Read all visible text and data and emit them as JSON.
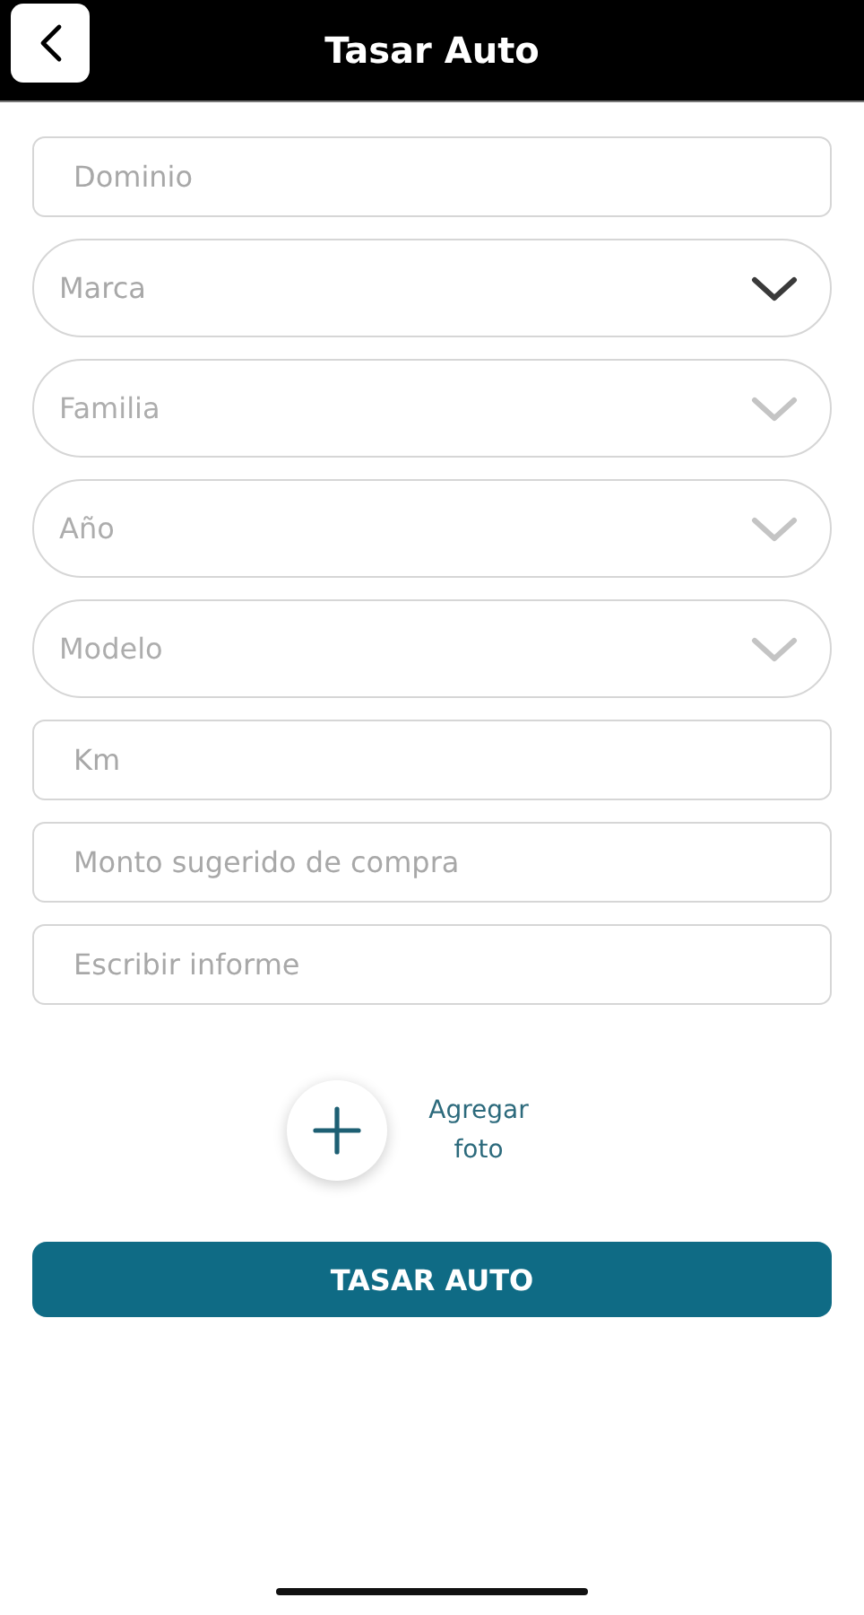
{
  "header": {
    "title": "Tasar Auto"
  },
  "fields": [
    {
      "kind": "text",
      "placeholder": "Dominio"
    },
    {
      "kind": "select",
      "placeholder": "Marca",
      "disabled": false
    },
    {
      "kind": "select",
      "placeholder": "Familia",
      "disabled": true
    },
    {
      "kind": "select",
      "placeholder": "Año",
      "disabled": true
    },
    {
      "kind": "select",
      "placeholder": "Modelo",
      "disabled": true
    },
    {
      "kind": "text",
      "placeholder": "Km"
    },
    {
      "kind": "text",
      "placeholder": "Monto sugerido de compra"
    },
    {
      "kind": "text",
      "placeholder": "Escribir informe"
    }
  ],
  "add_photo": {
    "label": "Agregar foto"
  },
  "submit_button": {
    "label": "TASAR AUTO"
  }
}
